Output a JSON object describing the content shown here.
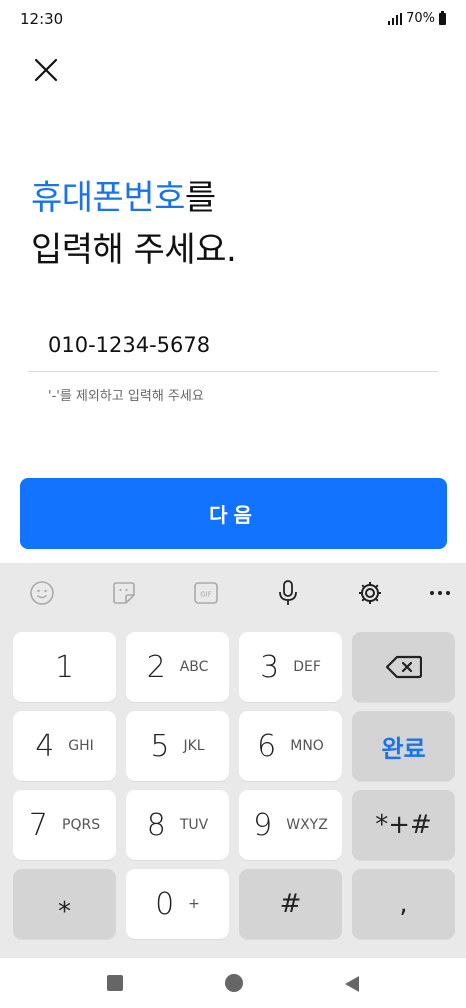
{
  "status_bar": {
    "time": "12:30",
    "battery": "70%"
  },
  "header": {
    "close_icon": "close-icon"
  },
  "title": {
    "accent": "휴대폰번호",
    "rest_line1": "를",
    "line2": "입력해 주세요."
  },
  "phone_input": {
    "value": "010-1234-5678"
  },
  "helper_text": "'-'를 제외하고 입력해 주세요",
  "next_button": {
    "label": "다음"
  },
  "keyboard": {
    "toolbar": [
      "emoji-icon",
      "sticker-icon",
      "gif-icon",
      "mic-icon",
      "gear-icon",
      "more-icon"
    ],
    "keys": {
      "k1": {
        "digit": "1",
        "letters": ""
      },
      "k2": {
        "digit": "2",
        "letters": "ABC"
      },
      "k3": {
        "digit": "3",
        "letters": "DEF"
      },
      "k4": {
        "digit": "4",
        "letters": "GHI"
      },
      "k5": {
        "digit": "5",
        "letters": "JKL"
      },
      "k6": {
        "digit": "6",
        "letters": "MNO"
      },
      "k7": {
        "digit": "7",
        "letters": "PQRS"
      },
      "k8": {
        "digit": "8",
        "letters": "TUV"
      },
      "k9": {
        "digit": "9",
        "letters": "WXYZ"
      },
      "k0": {
        "digit": "0",
        "letters": "+"
      },
      "star": "⁎",
      "hash": "#",
      "comma": ",",
      "symbols": "*+#",
      "done": "완료"
    },
    "accent_color": "#1173ff"
  }
}
